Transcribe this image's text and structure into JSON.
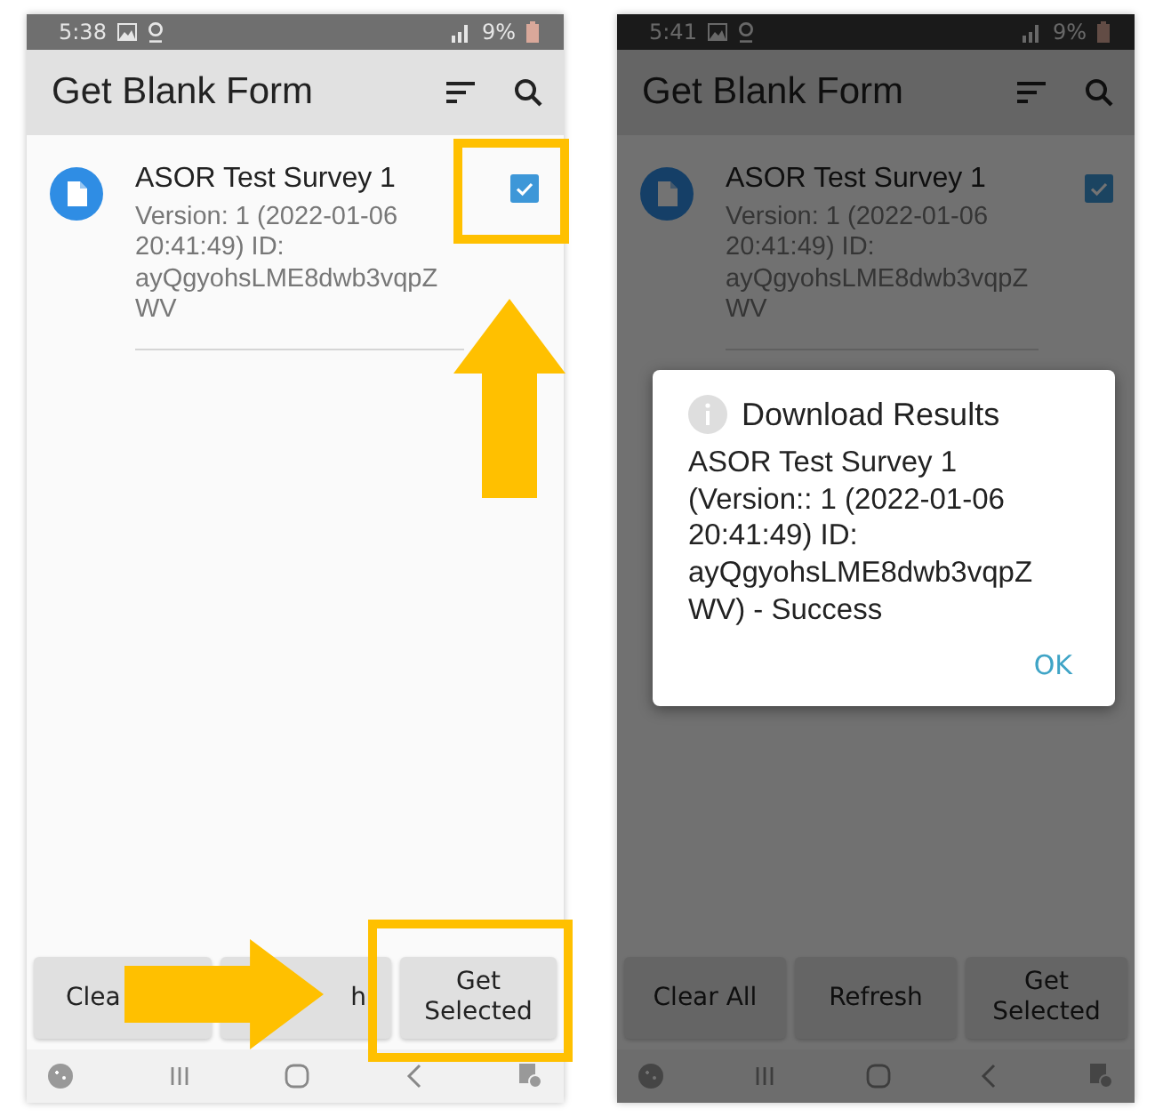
{
  "screens": [
    {
      "status_bar": {
        "time": "5:38",
        "battery": "9%"
      },
      "app_bar": {
        "title": "Get Blank Form"
      },
      "forms": [
        {
          "title": "ASOR Test Survey 1",
          "details": "Version: 1 (2022-01-06 20:41:49) ID: ayQgyohsLME8dwb3vqpZWV",
          "checked": true
        }
      ],
      "buttons": [
        "Clea",
        "h",
        "Get Selected"
      ],
      "dimmed": false
    },
    {
      "status_bar": {
        "time": "5:41",
        "battery": "9%"
      },
      "app_bar": {
        "title": "Get Blank Form"
      },
      "forms": [
        {
          "title": "ASOR Test Survey 1",
          "details": "Version: 1 (2022-01-06 20:41:49) ID: ayQgyohsLME8dwb3vqpZWV",
          "checked": true
        }
      ],
      "buttons": [
        "Clear All",
        "Refresh",
        "Get Selected"
      ],
      "dimmed": true,
      "dialog": {
        "title": "Download Results",
        "message": "ASOR Test Survey 1 (Version:: 1 (2022-01-06 20:41:49) ID: ayQgyohsLME8dwb3vqpZWV) - Success",
        "button": "OK"
      }
    }
  ]
}
